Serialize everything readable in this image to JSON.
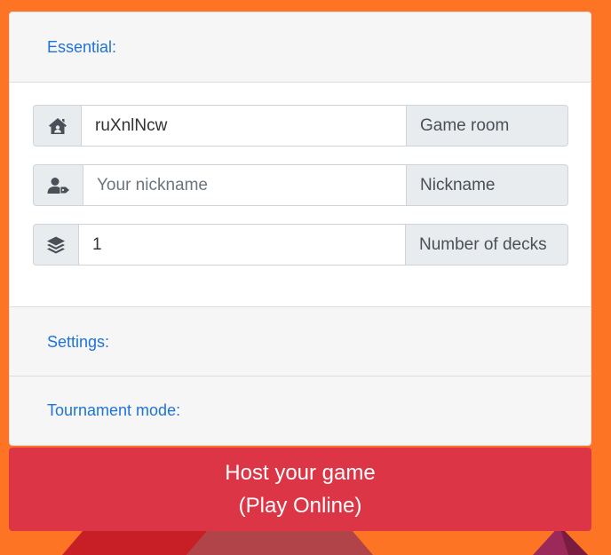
{
  "sections": {
    "essential": "Essential:",
    "settings": "Settings:",
    "tournament": "Tournament mode:"
  },
  "fields": {
    "game_room": {
      "value": "ruXnlNcw",
      "label": "Game room",
      "icon": "house-user-icon"
    },
    "nickname": {
      "value": "",
      "placeholder": "Your nickname",
      "label": "Nickname",
      "icon": "user-tag-icon"
    },
    "decks": {
      "value": "1",
      "label": "Number of decks",
      "icon": "layer-group-icon"
    }
  },
  "host_button": {
    "line1": "Host your game",
    "line2": "(Play Online)"
  },
  "colors": {
    "background": "#fd7524",
    "link": "#1e73d6",
    "button": "#dc3545"
  }
}
